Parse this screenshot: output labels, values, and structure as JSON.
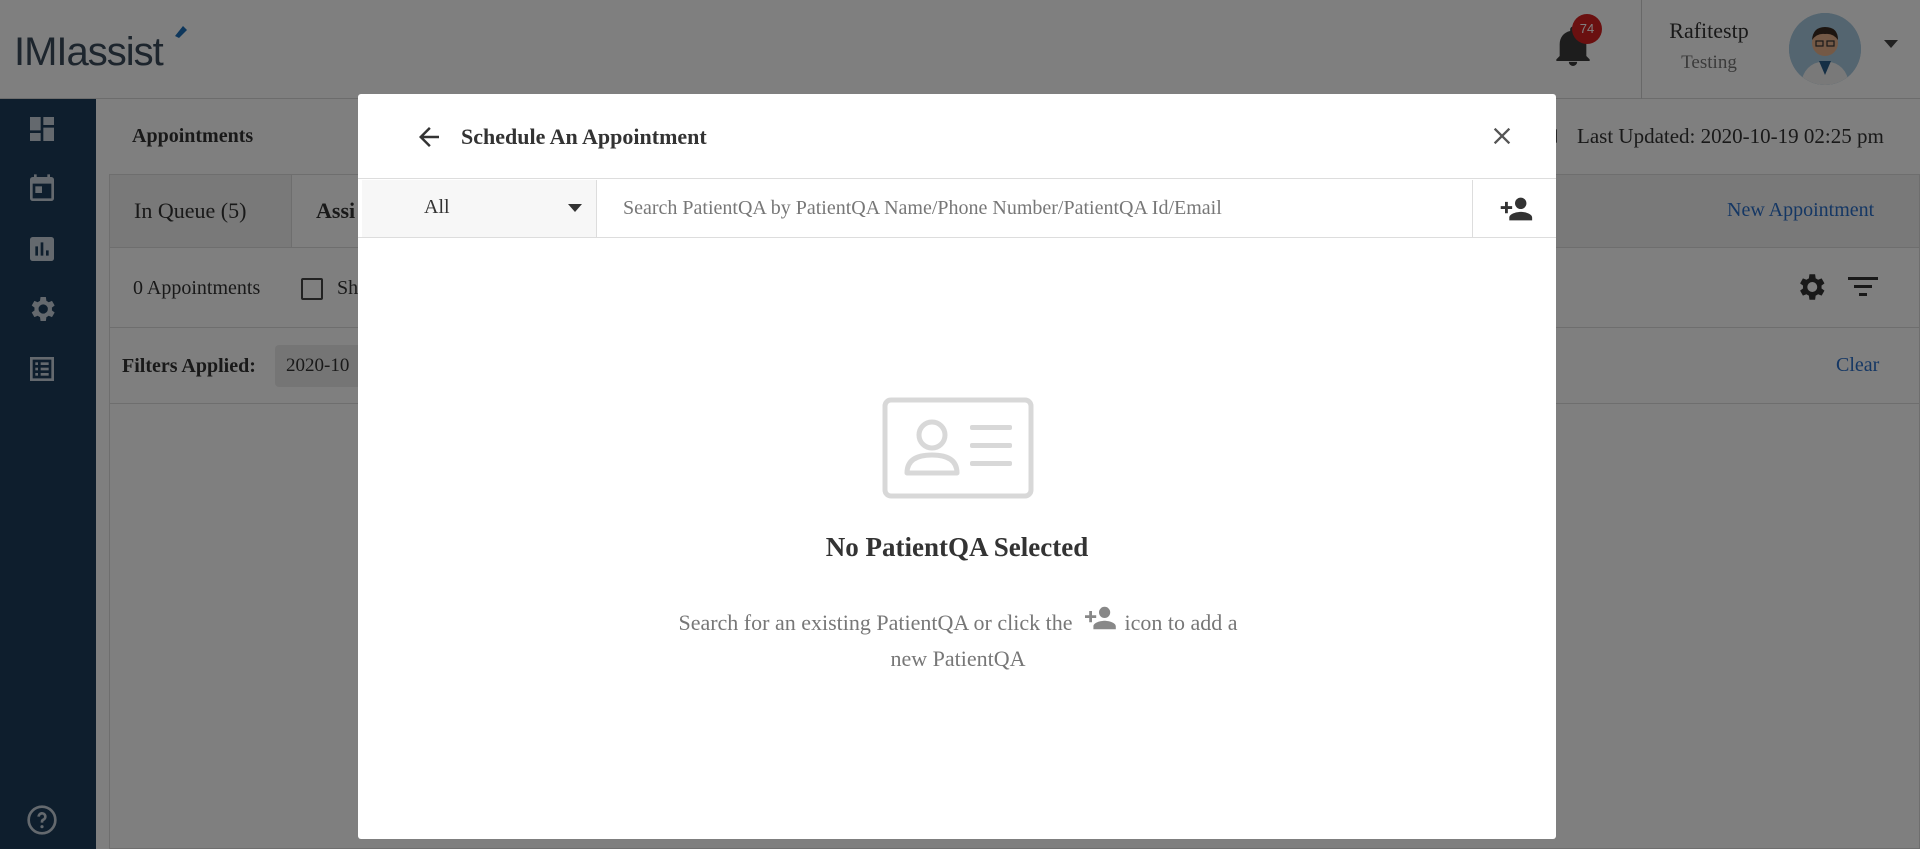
{
  "app": {
    "logo_part1": "IMI",
    "logo_part2": "assist",
    "notification_count": "74",
    "user_name": "Rafitestp",
    "user_role": "Testing"
  },
  "icons": {
    "dashboard": "dashboard-icon",
    "calendar": "calendar-icon",
    "reports": "bar-chart-icon",
    "settings": "gear-icon",
    "list": "list-icon",
    "help": "help-icon",
    "bell": "bell-icon",
    "add_user": "add-person-icon",
    "back": "arrow-left-icon",
    "close": "close-icon",
    "empty_state": "id-card-icon"
  },
  "page": {
    "breadcrumb": "Appointments",
    "last_updated": "Last Updated: 2020-10-19 02:25 pm",
    "tabs": [
      {
        "label": "In Queue (5)"
      },
      {
        "label": "Assi"
      }
    ],
    "new_appointment": "New Appointment",
    "count": "0 Appointments",
    "checkbox_label": "Sh",
    "filters_label": "Filters Applied:",
    "filter_chip": "2020-10",
    "clear": "Clear"
  },
  "modal": {
    "title": "Schedule An Appointment",
    "filter_value": "All",
    "search_placeholder": "Search PatientQA by PatientQA Name/Phone Number/PatientQA Id/Email",
    "search_value": "",
    "empty_title": "No PatientQA Selected",
    "empty_desc_before": "Search for an existing PatientQA or click the",
    "empty_desc_after": "icon to add a new PatientQA"
  },
  "colors": {
    "sidebar": "#1c3d5a",
    "link": "#2a6fc9",
    "badge": "#d42020",
    "overlay": "rgba(0,0,0,0.5)"
  }
}
